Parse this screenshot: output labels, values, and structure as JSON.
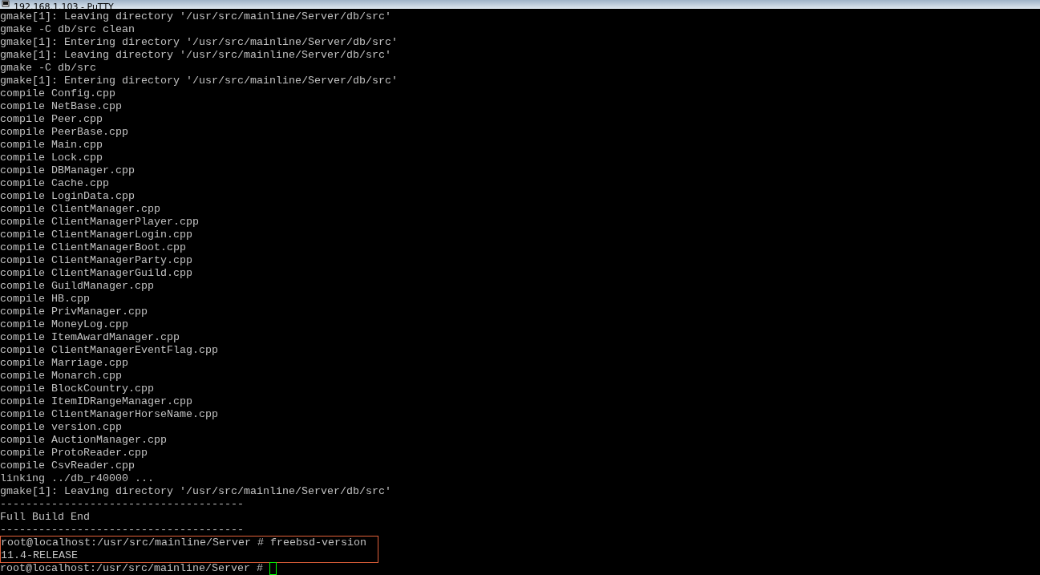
{
  "window": {
    "title": "192.168.1.103 - PuTTY"
  },
  "terminal": {
    "lines": [
      "gmake[1]: Leaving directory '/usr/src/mainline/Server/db/src'",
      "gmake -C db/src clean",
      "gmake[1]: Entering directory '/usr/src/mainline/Server/db/src'",
      "gmake[1]: Leaving directory '/usr/src/mainline/Server/db/src'",
      "gmake -C db/src",
      "gmake[1]: Entering directory '/usr/src/mainline/Server/db/src'",
      "compile Config.cpp",
      "compile NetBase.cpp",
      "compile Peer.cpp",
      "compile PeerBase.cpp",
      "compile Main.cpp",
      "compile Lock.cpp",
      "compile DBManager.cpp",
      "compile Cache.cpp",
      "compile LoginData.cpp",
      "compile ClientManager.cpp",
      "compile ClientManagerPlayer.cpp",
      "compile ClientManagerLogin.cpp",
      "compile ClientManagerBoot.cpp",
      "compile ClientManagerParty.cpp",
      "compile ClientManagerGuild.cpp",
      "compile GuildManager.cpp",
      "compile HB.cpp",
      "compile PrivManager.cpp",
      "compile MoneyLog.cpp",
      "compile ItemAwardManager.cpp",
      "compile ClientManagerEventFlag.cpp",
      "compile Marriage.cpp",
      "compile Monarch.cpp",
      "compile BlockCountry.cpp",
      "compile ItemIDRangeManager.cpp",
      "compile ClientManagerHorseName.cpp",
      "compile version.cpp",
      "compile AuctionManager.cpp",
      "compile ProtoReader.cpp",
      "compile CsvReader.cpp",
      "linking ../db_r40000 ...",
      "gmake[1]: Leaving directory '/usr/src/mainline/Server/db/src'",
      "--------------------------------------",
      "Full Build End",
      "--------------------------------------"
    ],
    "highlight_box": {
      "lines": [
        "root@localhost:/usr/src/mainline/Server # freebsd-version",
        "11.4-RELEASE"
      ]
    },
    "prompt": {
      "text": "root@localhost:/usr/src/mainline/Server #",
      "cursor": true
    }
  }
}
